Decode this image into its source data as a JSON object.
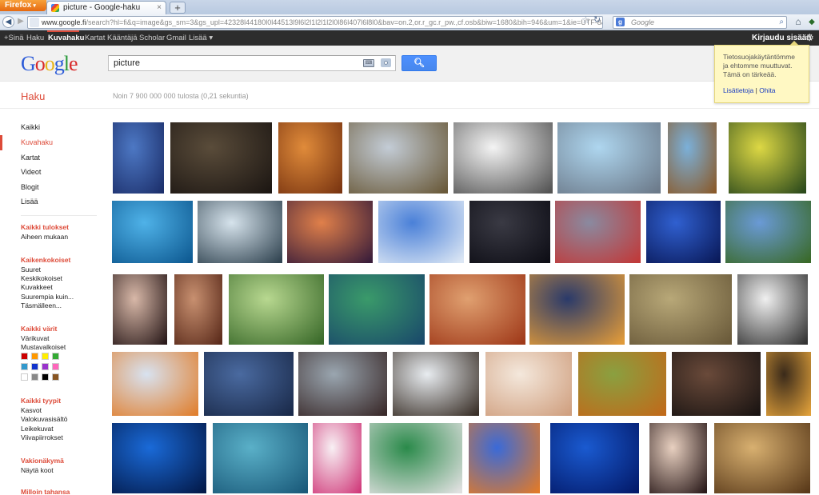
{
  "browser": {
    "menu_button": "Firefox",
    "tab_title": "picture - Google-haku",
    "new_tab": "+",
    "url_domain": "www.google.fi",
    "url_rest": "/search?hl=fi&q=image&gs_sm=3&gs_upl=42328l44180l0l44513l9l6l2l1l2l1l2l0l86l407l6l8l0&bav=on.2,or.r_gc.r_pw.,cf.osb&biw=1680&bih=946&um=1&ie=UTF-8&tbm=isch&source=og&sa=N&tab",
    "search_engine_placeholder": "Google"
  },
  "gbar": {
    "items": [
      "+Sinä",
      "Haku",
      "Kuvahaku",
      "Kartat",
      "Kääntäjä",
      "Scholar",
      "Gmail",
      "Lisää ▾"
    ],
    "signin": "Kirjaudu sisään"
  },
  "search": {
    "query": "picture",
    "button_icon": "search-icon"
  },
  "notice": {
    "text": "Tietosuojakäytäntömme ja ehtomme muuttuvat. Tämä on tärkeää.",
    "link_more": "Lisätietoja",
    "separator": " | ",
    "link_skip": "Ohita"
  },
  "results": {
    "section": "Haku",
    "stats": "Noin 7 900 000 000 tulosta (0,21 sekuntia)"
  },
  "leftnav": {
    "items": [
      "Kaikki",
      "Kuvahaku",
      "Kartat",
      "Videot",
      "Blogit",
      "Lisää"
    ],
    "selected_index": 1,
    "sections": [
      {
        "title": "Kaikki tulokset",
        "subs": [
          "Aiheen mukaan"
        ]
      },
      {
        "title": "Kaikenkokoiset",
        "subs": [
          "Suuret",
          "Keskikokoiset",
          "Kuvakkeet",
          "Suurempia kuin...",
          "Täsmälleen..."
        ]
      },
      {
        "title": "Kaikki värit",
        "subs": [
          "Värikuvat",
          "Mustavalkoiset"
        ]
      },
      {
        "title": "Kaikki tyypit",
        "subs": [
          "Kasvot",
          "Valokuvasisältö",
          "Leikekuvat",
          "Viivapiirrokset"
        ]
      },
      {
        "title": "Vakionäkymä",
        "subs": [
          "Näytä koot"
        ]
      },
      {
        "title": "Milloin tahansa",
        "subs": []
      }
    ],
    "swatch_colors": [
      "#cc0000",
      "#ff9900",
      "#ffee00",
      "#33aa33",
      "#3399cc",
      "#1133cc",
      "#9933cc",
      "#ff66bb",
      "#ffffff",
      "#888888",
      "#000000",
      "#885522"
    ]
  },
  "images": {
    "rows": [
      [
        {
          "alt": "eiffel-tower",
          "c1": "#4d78c4",
          "c2": "#1c2f6b"
        },
        {
          "alt": "photo-collage",
          "c1": "#5a4c3a",
          "c2": "#1d1713"
        },
        {
          "alt": "desert-sunset",
          "c1": "#e08b3a",
          "c2": "#7a3511"
        },
        {
          "alt": "cheetah",
          "c1": "#c3ccd6",
          "c2": "#6a5a3a"
        },
        {
          "alt": "dice",
          "c1": "#f4f4f4",
          "c2": "#555555"
        },
        {
          "alt": "mouse",
          "c1": "#aed6ef",
          "c2": "#6c7a8a"
        },
        {
          "alt": "pony",
          "c1": "#7bb0d9",
          "c2": "#8a5a2a"
        },
        {
          "alt": "ducklings",
          "c1": "#ddd844",
          "c2": "#2c4a1c"
        }
      ],
      [
        {
          "alt": "dolphin",
          "c1": "#4fb2e8",
          "c2": "#0e5a92"
        },
        {
          "alt": "penguins",
          "c1": "#d6e3ec",
          "c2": "#324552"
        },
        {
          "alt": "ocean-sunset",
          "c1": "#e0804a",
          "c2": "#3a1d3a"
        },
        {
          "alt": "software-screenshot",
          "c1": "#4a80d8",
          "c2": "#dbe6f4"
        },
        {
          "alt": "lightning",
          "c1": "#3a3a44",
          "c2": "#0e0e16"
        },
        {
          "alt": "times-square",
          "c1": "#8a8aa0",
          "c2": "#c03a3a"
        },
        {
          "alt": "footballer",
          "c1": "#3060d0",
          "c2": "#0a1a5a"
        },
        {
          "alt": "mountain-landscape",
          "c1": "#6a9ad6",
          "c2": "#3a6a2a"
        }
      ],
      [
        {
          "alt": "woman-portrait",
          "c1": "#d8b8a8",
          "c2": "#2a1a1a"
        },
        {
          "alt": "girl-portrait",
          "c1": "#c89070",
          "c2": "#5a2a1a"
        },
        {
          "alt": "butterfly",
          "c1": "#b8d890",
          "c2": "#3a6a2a"
        },
        {
          "alt": "peacock",
          "c1": "#3a9a6a",
          "c2": "#1a4a6a"
        },
        {
          "alt": "desert-canyon",
          "c1": "#e0a070",
          "c2": "#a03a1a"
        },
        {
          "alt": "tree-sunset",
          "c1": "#2a3a6a",
          "c2": "#e09a3a"
        },
        {
          "alt": "girl-in-field",
          "c1": "#b8a878",
          "c2": "#6a5a3a"
        },
        {
          "alt": "picture-gallery-camera",
          "c1": "#f0f0f0",
          "c2": "#333333"
        }
      ],
      [
        {
          "alt": "tiger-drawing-app",
          "c1": "#d8e2f0",
          "c2": "#e08030"
        },
        {
          "alt": "lake-reflection",
          "c1": "#4a6aa0",
          "c2": "#1a2a4a"
        },
        {
          "alt": "girl-with-cat",
          "c1": "#9aa6b0",
          "c2": "#3a2a2a"
        },
        {
          "alt": "bear-cub",
          "c1": "#e8ecf0",
          "c2": "#3a3028"
        },
        {
          "alt": "hands-hello",
          "c1": "#f4e8dc",
          "c2": "#d0a080"
        },
        {
          "alt": "tiger",
          "c1": "#8aa040",
          "c2": "#c06a1a"
        },
        {
          "alt": "interior-room",
          "c1": "#6a4a3a",
          "c2": "#1a1412"
        },
        {
          "alt": "eiffel-tower-night",
          "c1": "#3a2a1a",
          "c2": "#e0a03a"
        }
      ],
      [
        {
          "alt": "blue-abstract",
          "c1": "#1a6ad8",
          "c2": "#031a4a"
        },
        {
          "alt": "dolphin-underwater",
          "c1": "#5ab0c8",
          "c2": "#1a5a7a"
        },
        {
          "alt": "movie-poster",
          "c1": "#f8f0f4",
          "c2": "#d03a7a"
        },
        {
          "alt": "optical-illusion",
          "c1": "#2a8a4a",
          "c2": "#e0e0e0"
        },
        {
          "alt": "bluebird",
          "c1": "#3a6ad8",
          "c2": "#e07a2a"
        },
        {
          "alt": "underwater",
          "c1": "#1a5ad0",
          "c2": "#031a6a"
        },
        {
          "alt": "woman-smiling",
          "c1": "#e8d0c0",
          "c2": "#2a1a1a"
        },
        {
          "alt": "lion",
          "c1": "#d8b070",
          "c2": "#5a3a1a"
        }
      ]
    ]
  }
}
